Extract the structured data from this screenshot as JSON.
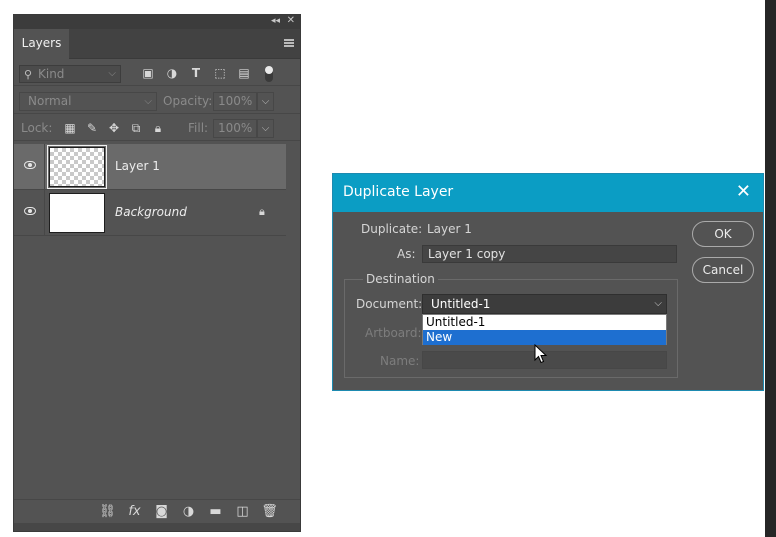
{
  "layers_panel": {
    "tab_label": "Layers",
    "filter": {
      "kind_placeholder": "Kind"
    },
    "blend_mode": "Normal",
    "opacity_label": "Opacity:",
    "opacity_value": "100%",
    "lock_label": "Lock:",
    "fill_label": "Fill:",
    "fill_value": "100%",
    "layers": [
      {
        "name": "Layer 1",
        "selected": true,
        "visible": true
      },
      {
        "name": "Background",
        "selected": false,
        "visible": true,
        "locked": true
      }
    ]
  },
  "dialog": {
    "title": "Duplicate Layer",
    "duplicate_label": "Duplicate:",
    "duplicate_value": "Layer 1",
    "as_label": "As:",
    "as_value": "Layer 1 copy",
    "destination_label": "Destination",
    "document_label": "Document:",
    "document_value": "Untitled-1",
    "document_options": [
      "Untitled-1",
      "New"
    ],
    "highlighted_option": "New",
    "artboard_label": "Artboard:",
    "name_label": "Name:",
    "ok_label": "OK",
    "cancel_label": "Cancel"
  },
  "colors": {
    "dialog_titlebar": "#0b9dc4",
    "panel_bg": "#535353",
    "dropdown_highlight": "#1e6fd0"
  }
}
